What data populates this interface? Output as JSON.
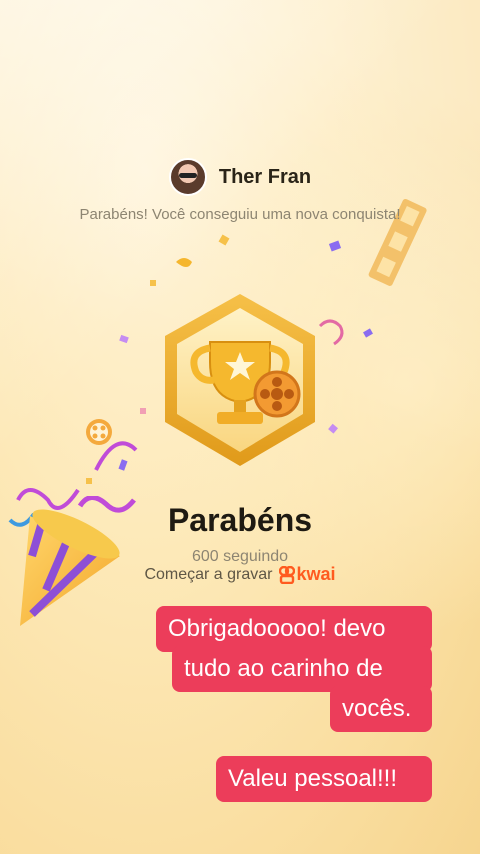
{
  "header": {
    "username": "Ther Fran",
    "subtitle": "Parabéns! Você conseguiu uma nova conquista!"
  },
  "achievement": {
    "title": "Parabéns",
    "followers": "600 seguindo",
    "record_label": "Começar a gravar",
    "brand": "kwai"
  },
  "captions": {
    "line1": "Obrigadooooo! devo",
    "line2": "tudo ao carinho de",
    "line3": "vocês.",
    "line4": "Valeu pessoal!!!"
  },
  "colors": {
    "caption_bg": "#ec3d5a",
    "brand": "#ff5a1f",
    "medal_gold": "#f3b52c"
  },
  "icons": [
    "trophy-icon",
    "star-icon",
    "film-reel-icon",
    "party-popper-icon",
    "kwai-logo-icon"
  ]
}
